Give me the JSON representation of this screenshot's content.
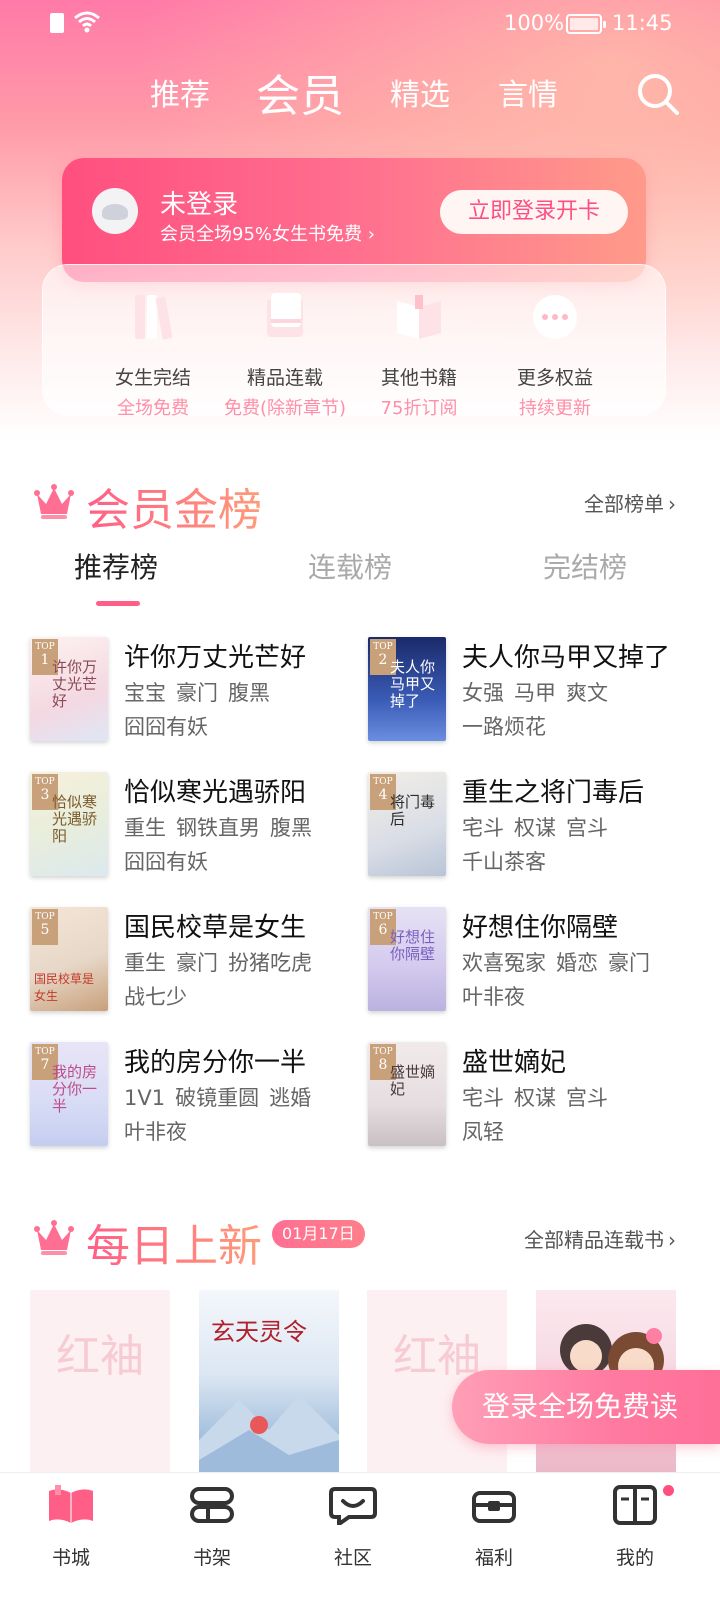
{
  "status_bar": {
    "battery": "100%",
    "time": "11:45"
  },
  "top_tabs": [
    {
      "label": "推荐"
    },
    {
      "label": "会员",
      "active": true
    },
    {
      "label": "精选"
    },
    {
      "label": "言情"
    }
  ],
  "member_card": {
    "title": "未登录",
    "subtitle": "会员全场95%女生书免费 ›",
    "login_button": "立即登录开卡"
  },
  "benefits": [
    {
      "name": "女生完结",
      "desc": "全场免费",
      "icon": "books-icon"
    },
    {
      "name": "精品连载",
      "desc": "免费(除新章节)",
      "icon": "book-stack-icon"
    },
    {
      "name": "其他书籍",
      "desc": "75折订阅",
      "icon": "open-book-icon"
    },
    {
      "name": "更多权益",
      "desc": "持续更新",
      "icon": "more-dots-icon"
    }
  ],
  "ranking_section": {
    "title": "会员金榜",
    "more": "全部榜单",
    "tabs": [
      "推荐榜",
      "连载榜",
      "完结榜"
    ],
    "books": [
      {
        "rank": "1",
        "title": "许你万丈光芒好",
        "tags": [
          "宝宝",
          "豪门",
          "腹黑"
        ],
        "author": "囧囧有妖",
        "cover_text": "许你万丈光芒好"
      },
      {
        "rank": "2",
        "title": "夫人你马甲又掉了",
        "tags": [
          "女强",
          "马甲",
          "爽文"
        ],
        "author": "一路烦花",
        "cover_text": "夫人你马甲又掉了"
      },
      {
        "rank": "3",
        "title": "恰似寒光遇骄阳",
        "tags": [
          "重生",
          "钢铁直男",
          "腹黑"
        ],
        "author": "囧囧有妖",
        "cover_text": "恰似寒光遇骄阳"
      },
      {
        "rank": "4",
        "title": "重生之将门毒后",
        "tags": [
          "宅斗",
          "权谋",
          "宫斗"
        ],
        "author": "千山茶客",
        "cover_text": "将门毒后"
      },
      {
        "rank": "5",
        "title": "国民校草是女生",
        "tags": [
          "重生",
          "豪门",
          "扮猪吃虎"
        ],
        "author": "战七少",
        "cover_text": "国民校草是女生"
      },
      {
        "rank": "6",
        "title": "好想住你隔壁",
        "tags": [
          "欢喜冤家",
          "婚恋",
          "豪门"
        ],
        "author": "叶非夜",
        "cover_text": "好想住你隔壁"
      },
      {
        "rank": "7",
        "title": "我的房分你一半",
        "tags": [
          "1V1",
          "破镜重圆",
          "逃婚"
        ],
        "author": "叶非夜",
        "cover_text": "我的房分你一半"
      },
      {
        "rank": "8",
        "title": "盛世嫡妃",
        "tags": [
          "宅斗",
          "权谋",
          "宫斗"
        ],
        "author": "凤轻",
        "cover_text": "盛世嫡妃"
      }
    ]
  },
  "daily_section": {
    "title": "每日上新",
    "date": "01月17日",
    "more": "全部精品连载书",
    "covers": [
      {
        "type": "placeholder",
        "text": "红袖"
      },
      {
        "type": "image",
        "text": "玄天灵令"
      },
      {
        "type": "placeholder",
        "text": "红袖"
      },
      {
        "type": "image",
        "text": ""
      }
    ]
  },
  "float_button": "登录全场免费读",
  "bottom_nav": [
    {
      "label": "书城",
      "icon": "bookstore-icon",
      "active": true
    },
    {
      "label": "书架",
      "icon": "bookshelf-icon"
    },
    {
      "label": "社区",
      "icon": "community-icon"
    },
    {
      "label": "福利",
      "icon": "gift-box-icon"
    },
    {
      "label": "我的",
      "icon": "profile-icon"
    }
  ],
  "colors": {
    "accent": "#ff5f86",
    "hero_top": "#ff7aa8",
    "hero_mid": "#ffc9c9"
  }
}
